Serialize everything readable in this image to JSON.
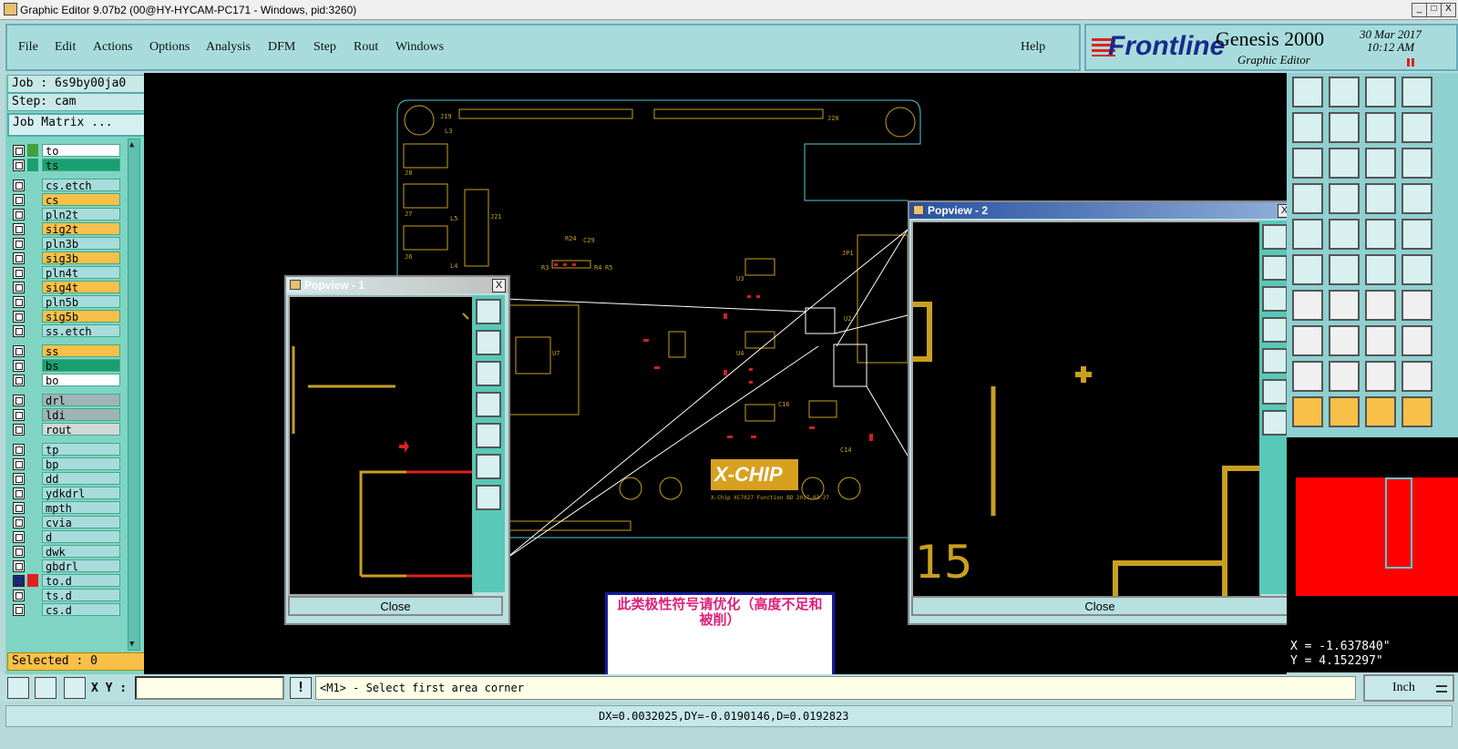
{
  "window": {
    "title": "Graphic Editor 9.07b2 (00@HY-HYCAM-PC171 - Windows, pid:3260)",
    "btn_min": "_",
    "btn_max": "□",
    "btn_close": "X"
  },
  "menu": {
    "items": [
      "File",
      "Edit",
      "Actions",
      "Options",
      "Analysis",
      "DFM",
      "Step",
      "Rout",
      "Windows"
    ],
    "help": "Help"
  },
  "brand": {
    "logo": "Frontline",
    "product": "Genesis 2000",
    "subtitle": "Graphic Editor",
    "date": "30 Mar 2017",
    "time": "10:12 AM",
    "logo_color": "#1a2a8c",
    "stripe_color": "#e02020"
  },
  "left": {
    "job": "Job : 6s9by00ja0",
    "step": "Step: cam",
    "job_matrix": "Job Matrix ...",
    "selected": "Selected : 0",
    "layers": [
      {
        "name": "to",
        "fill": "#ffffff",
        "swatch": "#40a040"
      },
      {
        "name": "ts",
        "fill": "#1aa070",
        "swatch": "#1aa070"
      },
      {
        "name": "cs.etch",
        "fill": "#a8dcdc",
        "swatch": ""
      },
      {
        "name": "cs",
        "fill": "#f8c048",
        "swatch": ""
      },
      {
        "name": "pln2t",
        "fill": "#a8dcdc",
        "swatch": ""
      },
      {
        "name": "sig2t",
        "fill": "#f8c048",
        "swatch": ""
      },
      {
        "name": "pln3b",
        "fill": "#a8dcdc",
        "swatch": ""
      },
      {
        "name": "sig3b",
        "fill": "#f8c048",
        "swatch": ""
      },
      {
        "name": "pln4t",
        "fill": "#a8dcdc",
        "swatch": ""
      },
      {
        "name": "sig4t",
        "fill": "#f8c048",
        "swatch": ""
      },
      {
        "name": "pln5b",
        "fill": "#a8dcdc",
        "swatch": ""
      },
      {
        "name": "sig5b",
        "fill": "#f8c048",
        "swatch": ""
      },
      {
        "name": "ss.etch",
        "fill": "#a8dcdc",
        "swatch": ""
      },
      {
        "name": "ss",
        "fill": "#f8c048",
        "swatch": ""
      },
      {
        "name": "bs",
        "fill": "#1aa070",
        "swatch": ""
      },
      {
        "name": "bo",
        "fill": "#ffffff",
        "swatch": ""
      },
      {
        "name": "drl",
        "fill": "#a0b4b8",
        "swatch": ""
      },
      {
        "name": "ldi",
        "fill": "#a0b4b8",
        "swatch": ""
      },
      {
        "name": "rout",
        "fill": "#d0d8d8",
        "swatch": ""
      },
      {
        "name": "tp",
        "fill": "#a8dcdc",
        "swatch": ""
      },
      {
        "name": "bp",
        "fill": "#a8dcdc",
        "swatch": ""
      },
      {
        "name": "dd",
        "fill": "#a8dcdc",
        "swatch": ""
      },
      {
        "name": "ydkdrl",
        "fill": "#a8dcdc",
        "swatch": ""
      },
      {
        "name": "mpth",
        "fill": "#a8dcdc",
        "swatch": ""
      },
      {
        "name": "cvia",
        "fill": "#a8dcdc",
        "swatch": ""
      },
      {
        "name": "d",
        "fill": "#a8dcdc",
        "swatch": ""
      },
      {
        "name": "dwk",
        "fill": "#a8dcdc",
        "swatch": ""
      },
      {
        "name": "gbdrl",
        "fill": "#a8dcdc",
        "swatch": ""
      },
      {
        "name": "to.d",
        "fill": "#a8dcdc",
        "swatch": "#e02020"
      },
      {
        "name": "ts.d",
        "fill": "#a8dcdc",
        "swatch": ""
      },
      {
        "name": "cs.d",
        "fill": "#a8dcdc",
        "swatch": ""
      }
    ]
  },
  "popups": {
    "p1_title": "Popview - 1",
    "p2_title": "Popview - 2",
    "close_label": "Close",
    "close_x": "X",
    "p2_text": "15"
  },
  "board": {
    "logo": "X-CHIP",
    "logo_sub": "X-Chip XC7027 Function BD    2017-03-27",
    "labels": [
      "J19",
      "J20",
      "J8",
      "J7",
      "J6",
      "J21",
      "R24",
      "C29",
      "R3",
      "R4",
      "R5",
      "U7",
      "JP1",
      "U2",
      "U3",
      "U4",
      "C16",
      "C14",
      "L3",
      "L4",
      "L5"
    ]
  },
  "annotation": {
    "text": "此类极性符号请优化（高度不足和被削）",
    "color": "#e0207a"
  },
  "coords": {
    "x": "X = -1.637840\"",
    "y": "Y =  4.152297\""
  },
  "status": {
    "xy_label": "X Y :",
    "xy_value": "",
    "message": "<M1> - Select first area corner",
    "units": "Inch",
    "measure": "DX=0.0032025,DY=-0.0190146,D=0.0192823",
    "warn": "!"
  }
}
